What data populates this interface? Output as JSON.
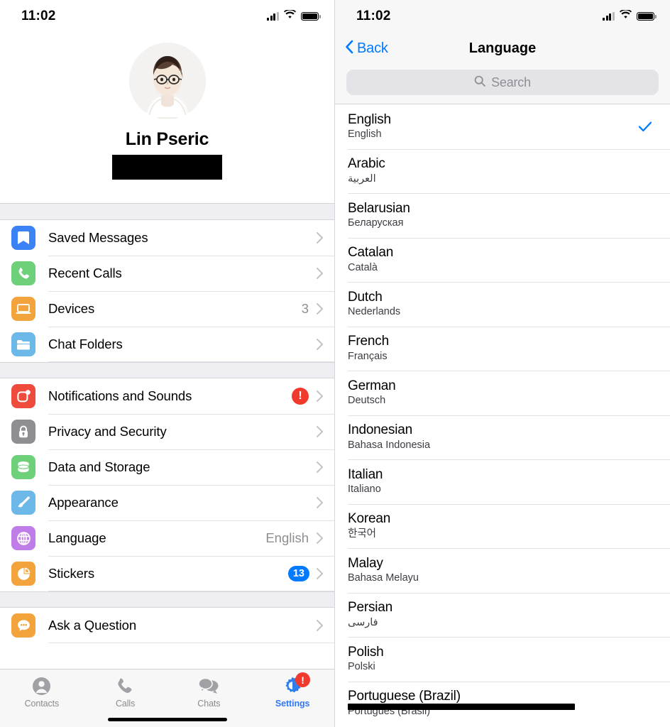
{
  "status_bar": {
    "time": "11:02",
    "signal_icon": "cellular-signal-icon",
    "wifi_icon": "wifi-icon",
    "battery_icon": "battery-icon"
  },
  "left_panel": {
    "profile": {
      "name": "Lin Pseric",
      "avatar_icon": "user-avatar",
      "phone_redacted": ""
    },
    "groups": [
      {
        "rows": [
          {
            "label": "Saved Messages",
            "icon": "bookmark-icon",
            "icon_color": "#3b82f6",
            "value": "",
            "badge": "",
            "alert": false
          },
          {
            "label": "Recent Calls",
            "icon": "phone-icon",
            "icon_color": "#6fd07a",
            "value": "",
            "badge": "",
            "alert": false
          },
          {
            "label": "Devices",
            "icon": "laptop-icon",
            "icon_color": "#f3a33c",
            "value": "3",
            "badge": "",
            "alert": false
          },
          {
            "label": "Chat Folders",
            "icon": "folder-icon",
            "icon_color": "#6cb8e8",
            "value": "",
            "badge": "",
            "alert": false
          }
        ]
      },
      {
        "rows": [
          {
            "label": "Notifications and Sounds",
            "icon": "notification-icon",
            "icon_color": "#ee4b3c",
            "value": "",
            "badge": "",
            "alert": true,
            "alert_glyph": "!"
          },
          {
            "label": "Privacy and Security",
            "icon": "lock-icon",
            "icon_color": "#8e8e93",
            "value": "",
            "badge": "",
            "alert": false
          },
          {
            "label": "Data and Storage",
            "icon": "database-icon",
            "icon_color": "#6fd07a",
            "value": "",
            "badge": "",
            "alert": false
          },
          {
            "label": "Appearance",
            "icon": "paintbrush-icon",
            "icon_color": "#6cb8e8",
            "value": "",
            "badge": "",
            "alert": false
          },
          {
            "label": "Language",
            "icon": "globe-icon",
            "icon_color": "#c07de8",
            "value": "English",
            "badge": "",
            "alert": false
          },
          {
            "label": "Stickers",
            "icon": "sticker-icon",
            "icon_color": "#f3a33c",
            "value": "",
            "badge": "13",
            "alert": false
          }
        ]
      },
      {
        "rows": [
          {
            "label": "Ask a Question",
            "icon": "chat-bubble-icon",
            "icon_color": "#f3a33c",
            "value": "",
            "badge": "",
            "alert": false
          }
        ]
      }
    ],
    "tabbar": [
      {
        "label": "Contacts",
        "icon": "contacts-icon",
        "active": false,
        "badge": ""
      },
      {
        "label": "Calls",
        "icon": "calls-icon",
        "active": false,
        "badge": ""
      },
      {
        "label": "Chats",
        "icon": "chats-icon",
        "active": false,
        "badge": ""
      },
      {
        "label": "Settings",
        "icon": "settings-gear-icon",
        "active": true,
        "badge": "!"
      }
    ]
  },
  "right_panel": {
    "nav": {
      "back_label": "Back",
      "title": "Language",
      "back_icon": "chevron-left-icon",
      "accent": "#007aff"
    },
    "search": {
      "placeholder": "Search",
      "value": "",
      "icon": "search-icon"
    },
    "languages": [
      {
        "name": "English",
        "native": "English",
        "selected": true
      },
      {
        "name": "Arabic",
        "native": "العربية",
        "selected": false
      },
      {
        "name": "Belarusian",
        "native": "Беларуская",
        "selected": false
      },
      {
        "name": "Catalan",
        "native": "Català",
        "selected": false
      },
      {
        "name": "Dutch",
        "native": "Nederlands",
        "selected": false
      },
      {
        "name": "French",
        "native": "Français",
        "selected": false
      },
      {
        "name": "German",
        "native": "Deutsch",
        "selected": false
      },
      {
        "name": "Indonesian",
        "native": "Bahasa Indonesia",
        "selected": false
      },
      {
        "name": "Italian",
        "native": "Italiano",
        "selected": false
      },
      {
        "name": "Korean",
        "native": "한국어",
        "selected": false
      },
      {
        "name": "Malay",
        "native": "Bahasa Melayu",
        "selected": false
      },
      {
        "name": "Persian",
        "native": "فارسی",
        "selected": false
      },
      {
        "name": "Polish",
        "native": "Polski",
        "selected": false
      },
      {
        "name": "Portuguese (Brazil)",
        "native": "Português (Brasil)",
        "selected": false
      }
    ]
  }
}
